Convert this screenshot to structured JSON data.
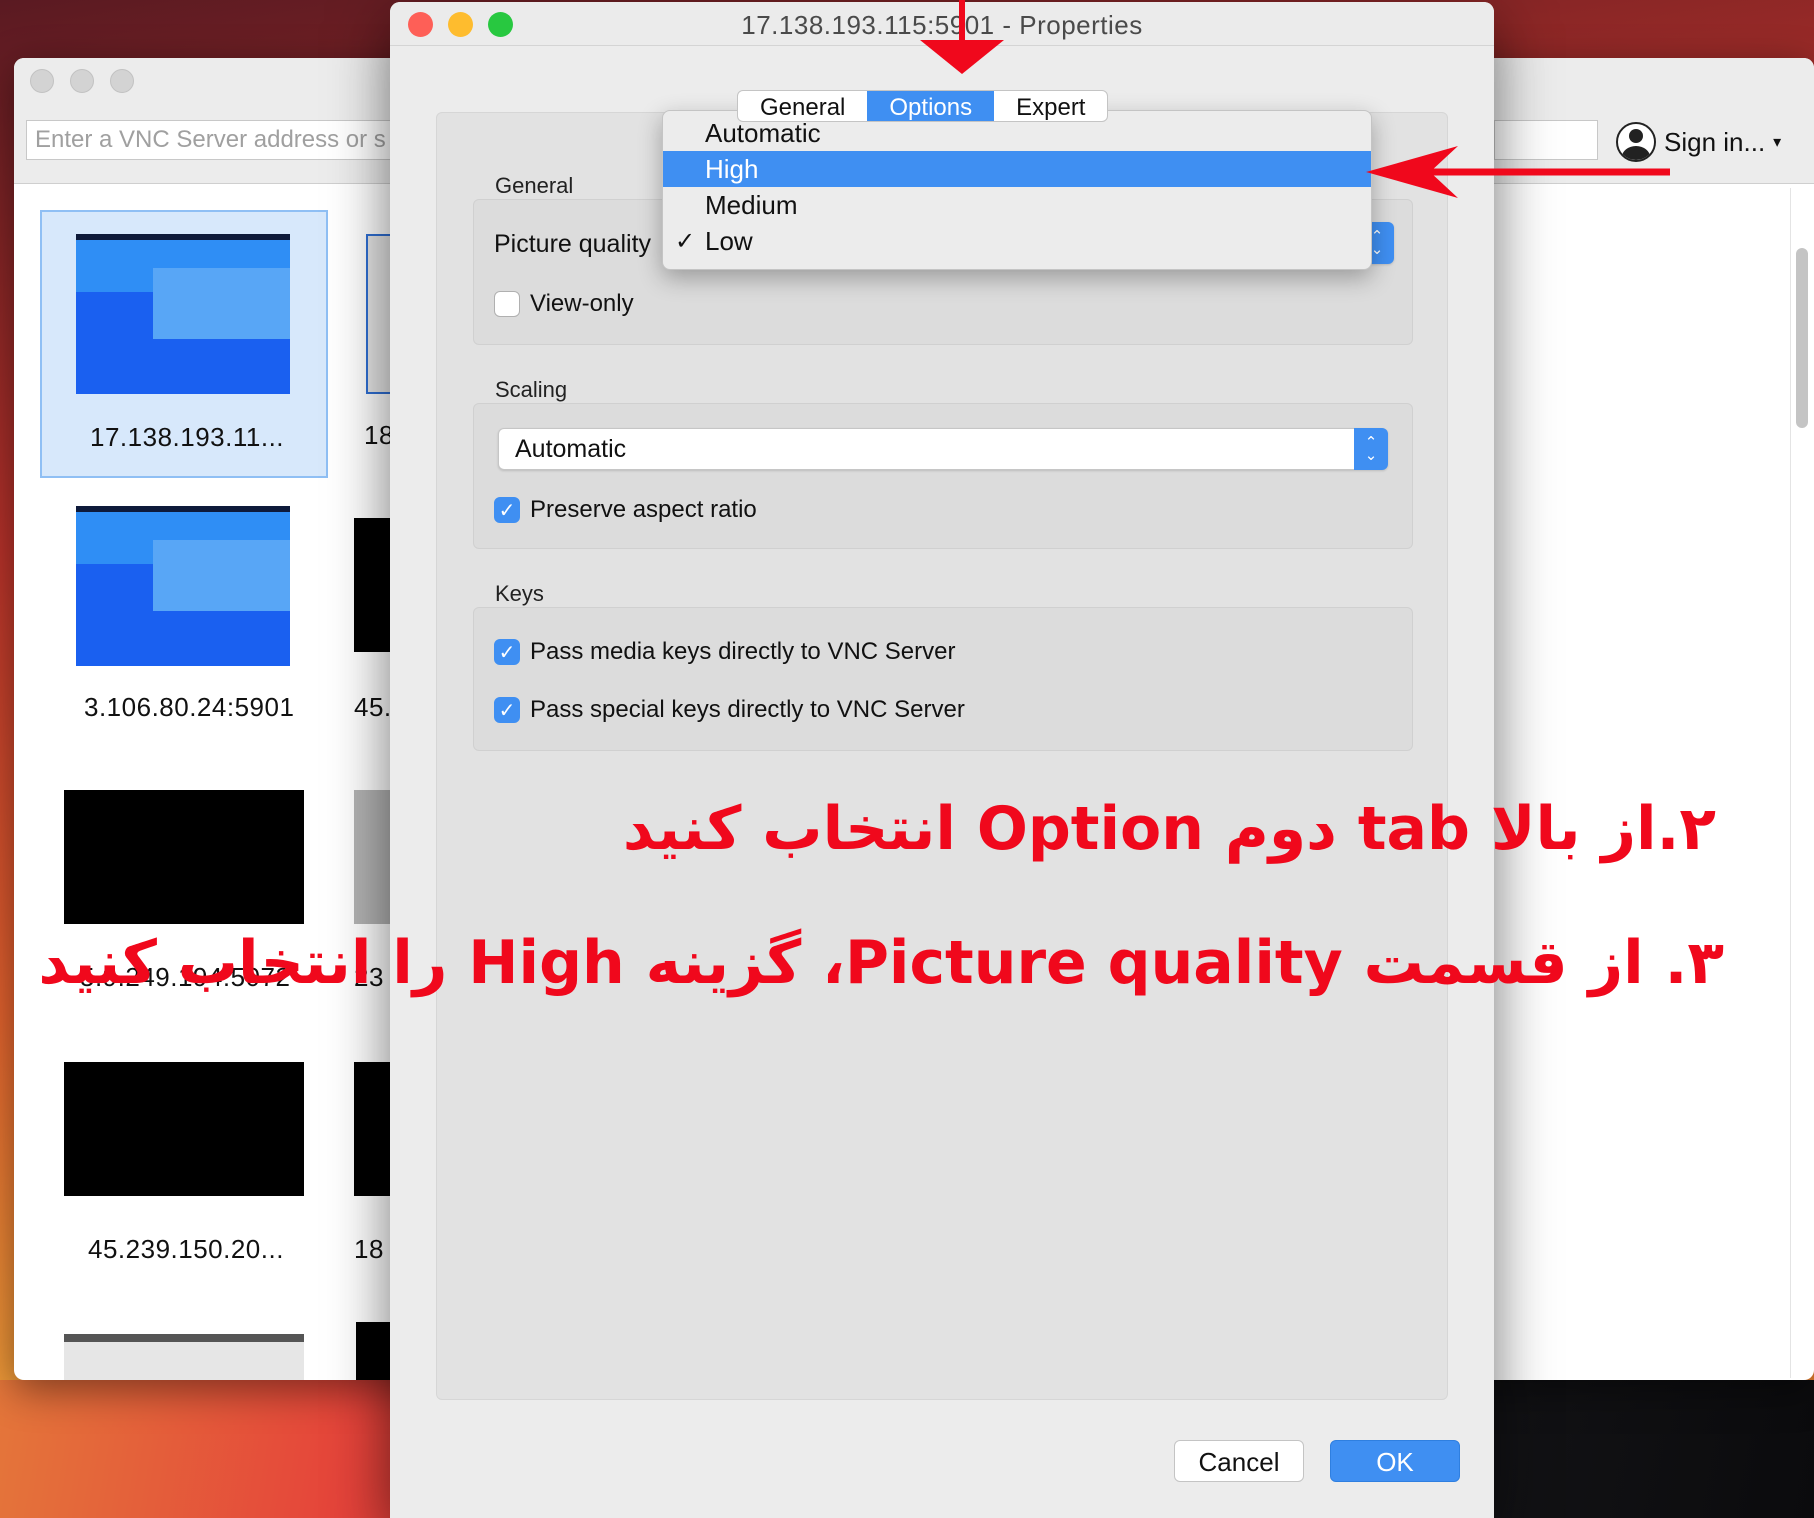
{
  "viewer": {
    "search_placeholder": "Enter a VNC Server address or s",
    "signin_label": "Sign in...",
    "signin_caret": "▾",
    "tiles": [
      {
        "label": "17.138.193.11..."
      },
      {
        "label": "18"
      },
      {
        "label": "3.106.80.24:5901"
      },
      {
        "label": "45."
      },
      {
        "label": "5.9.249.194:5072"
      },
      {
        "label": "23"
      },
      {
        "label": "45.239.150.20..."
      },
      {
        "label": "18"
      }
    ]
  },
  "dialog": {
    "title": "17.138.193.115:5901 - Properties",
    "tabs": [
      "General",
      "Options",
      "Expert"
    ],
    "active_tab": "Options",
    "sections": {
      "general": {
        "label": "General",
        "picture_quality_label": "Picture quality",
        "view_only_label": "View-only",
        "view_only_checked": false
      },
      "scaling": {
        "label": "Scaling",
        "value": "Automatic",
        "preserve_aspect_label": "Preserve aspect ratio",
        "preserve_aspect_checked": true
      },
      "keys": {
        "label": "Keys",
        "media_keys_label": "Pass media keys directly to VNC Server",
        "media_keys_checked": true,
        "special_keys_label": "Pass special keys directly to VNC Server",
        "special_keys_checked": true
      }
    },
    "buttons": {
      "cancel": "Cancel",
      "ok": "OK"
    }
  },
  "dropdown": {
    "items": [
      {
        "label": "Automatic",
        "checked": false,
        "highlighted": false
      },
      {
        "label": "High",
        "checked": false,
        "highlighted": true
      },
      {
        "label": "Medium",
        "checked": false,
        "highlighted": false
      },
      {
        "label": "Low",
        "checked": true,
        "highlighted": false
      }
    ],
    "check_glyph": "✓"
  },
  "annotations": {
    "line1": "۲.از بالا tab دوم Option انتخاب کنید",
    "line2": "۳. از قسمت Picture quality، گزینه High را انتخاب کنید"
  },
  "colors": {
    "accent": "#3f8ff2",
    "annotation_red": "#f0081c",
    "close": "#fe5f57",
    "minimize": "#febc2e",
    "zoom": "#28c840"
  }
}
